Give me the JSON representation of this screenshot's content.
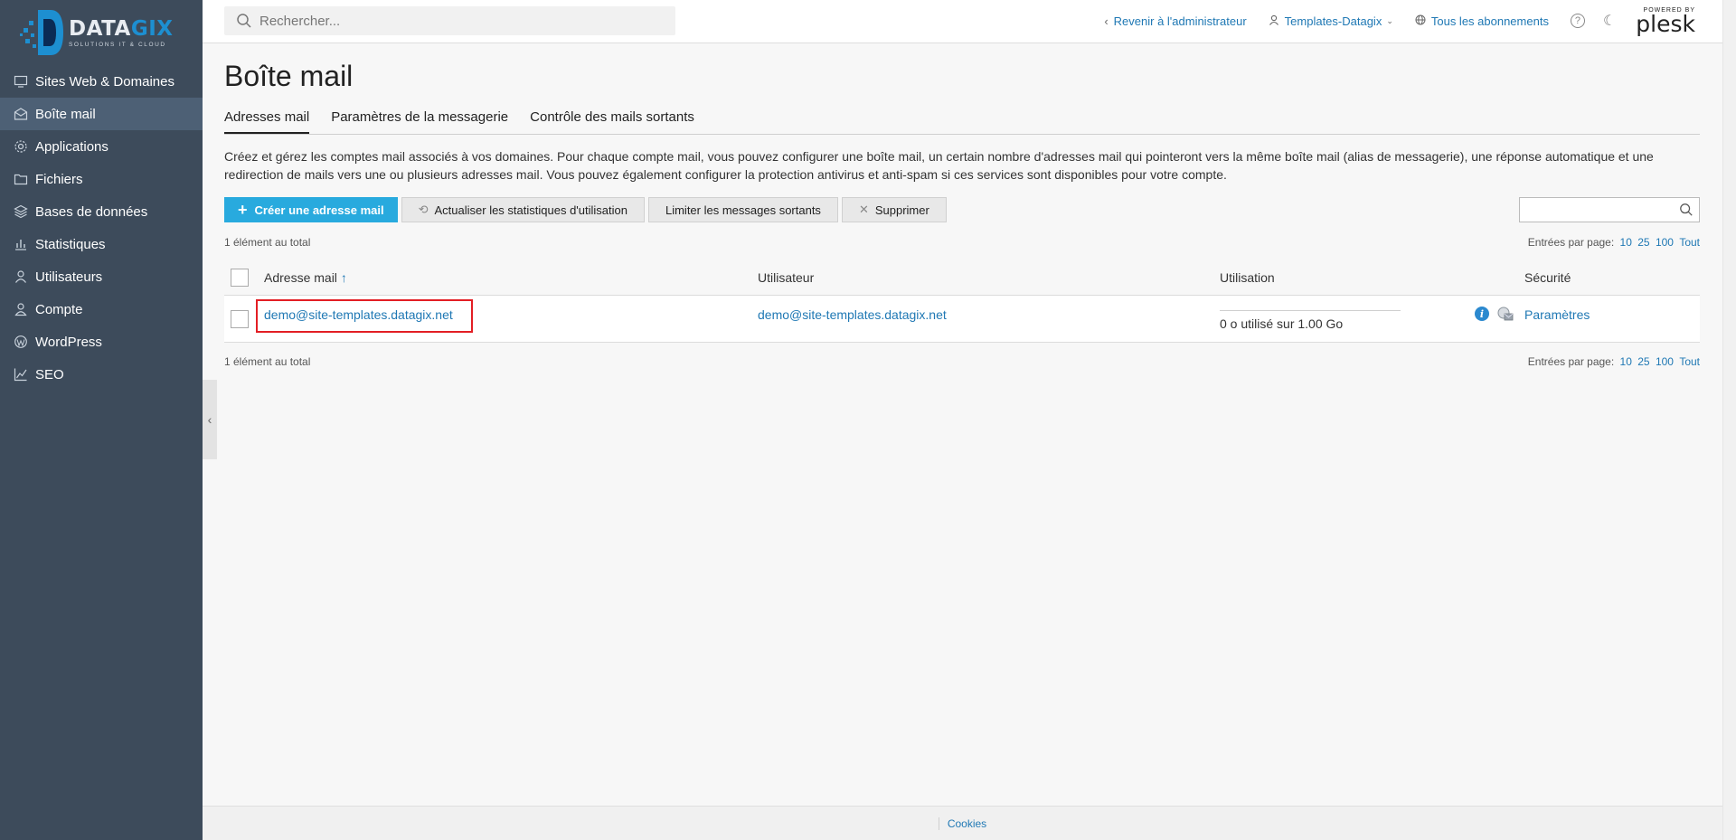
{
  "brand": {
    "name_part1": "DATA",
    "name_part2": "GIX",
    "tagline": "SOLUTIONS IT & CLOUD"
  },
  "sidebar": {
    "items": [
      {
        "label": "Sites Web & Domaines",
        "icon": "monitor-icon",
        "active": false
      },
      {
        "label": "Boîte mail",
        "icon": "envelope-icon",
        "active": true
      },
      {
        "label": "Applications",
        "icon": "gear-icon",
        "active": false
      },
      {
        "label": "Fichiers",
        "icon": "folder-icon",
        "active": false
      },
      {
        "label": "Bases de données",
        "icon": "database-icon",
        "active": false
      },
      {
        "label": "Statistiques",
        "icon": "bar-chart-icon",
        "active": false
      },
      {
        "label": "Utilisateurs",
        "icon": "user-icon",
        "active": false
      },
      {
        "label": "Compte",
        "icon": "account-icon",
        "active": false
      },
      {
        "label": "WordPress",
        "icon": "wordpress-icon",
        "active": false
      },
      {
        "label": "SEO",
        "icon": "seo-chart-icon",
        "active": false
      }
    ]
  },
  "header": {
    "search_placeholder": "Rechercher...",
    "back_admin": "Revenir à l'administrateur",
    "account": "Templates-Datagix",
    "subscriptions": "Tous les abonnements",
    "help": "?",
    "plesk_powered": "POWERED BY",
    "plesk_name": "plesk"
  },
  "page": {
    "title": "Boîte mail",
    "tabs": [
      "Adresses mail",
      "Paramètres de la messagerie",
      "Contrôle des mails sortants"
    ],
    "description": "Créez et gérez les comptes mail associés à vos domaines. Pour chaque compte mail, vous pouvez configurer une boîte mail, un certain nombre d'adresses mail qui pointeront vers la même boîte mail (alias de messagerie), une réponse automatique et une redirection de mails vers une ou plusieurs adresses mail. Vous pouvez également configurer la protection antivirus et anti-spam si ces services sont disponibles pour votre compte."
  },
  "toolbar": {
    "create": "Créer une adresse mail",
    "refresh": "Actualiser les statistiques d'utilisation",
    "limit": "Limiter les messages sortants",
    "delete": "Supprimer"
  },
  "list": {
    "total_text": "1 élément au total",
    "per_page_label": "Entrées par page:",
    "per_page_options": [
      "10",
      "25",
      "100",
      "Tout"
    ],
    "columns": {
      "mail": "Adresse mail",
      "sort_indicator": "↑",
      "user": "Utilisateur",
      "usage": "Utilisation",
      "security": "Sécurité"
    },
    "rows": [
      {
        "mail": "demo@site-templates.datagix.net",
        "user": "demo@site-templates.datagix.net",
        "usage": "0 o utilisé sur 1.00 Go",
        "security": "Paramètres",
        "usage_fraction": 0
      }
    ]
  },
  "footer": {
    "cookies": "Cookies"
  },
  "colors": {
    "sidebar": "#3d4b5b",
    "accent": "#28aade",
    "link": "#1f78b4",
    "highlight": "#e31e24"
  }
}
